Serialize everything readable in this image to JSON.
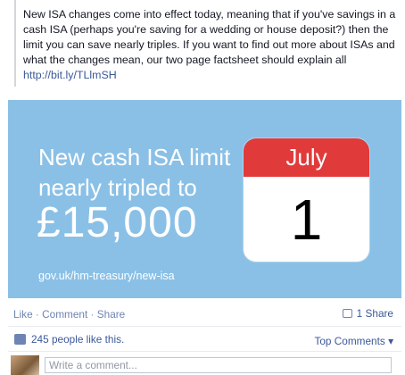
{
  "post": {
    "quote_text": "New ISA changes come into effect today, meaning that if you've savings in a cash ISA (perhaps you're saving for a wedding or house deposit?) then the limit you can save nearly triples. If you want to find out more about ISAs and what the changes mean, our two page factsheet should explain all",
    "quote_link": "http://bit.ly/TLlmSH"
  },
  "card": {
    "headline": "New cash ISA limit nearly tripled to",
    "amount": "£15,000",
    "source": "gov.uk/hm-treasury/new-isa",
    "calendar_month": "July",
    "calendar_day": "1",
    "background_color": "#8ac0e6",
    "calendar_color": "#e03b3a"
  },
  "actions": {
    "like": "Like",
    "sep1": " · ",
    "comment": "Comment",
    "sep2": " · ",
    "share": "Share",
    "share_count": "1 Share",
    "share_icon": "share-icon"
  },
  "likes": {
    "text": "245 people like this.",
    "icon": "thumbs-up-icon"
  },
  "comments": {
    "sort_label": "Top Comments ▾",
    "placeholder": "Write a comment..."
  }
}
